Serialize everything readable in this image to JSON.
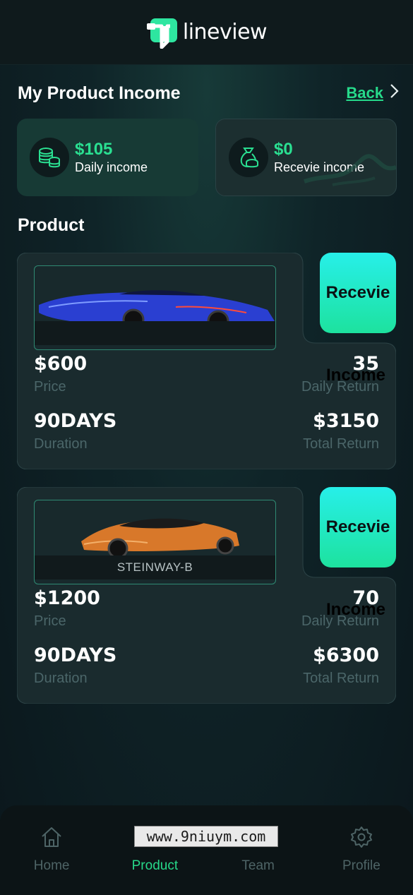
{
  "header": {
    "logo_text": "lineview"
  },
  "page": {
    "title": "My Product Income",
    "back_label": "Back"
  },
  "income_cards": [
    {
      "amount": "$105",
      "label": "Daily income",
      "icon": "coins-icon"
    },
    {
      "amount": "$0",
      "label": "Recevie income",
      "icon": "money-bag-icon"
    }
  ],
  "product_section": {
    "title": "Product"
  },
  "products": [
    {
      "car_name": "",
      "car_color": "#2a3fd1",
      "button_label": "Recevie",
      "overlay_text": "Income",
      "price": "$600",
      "price_label": "Price",
      "daily_return": "35",
      "daily_return_label": "Daily Return",
      "duration": "90DAYS",
      "duration_label": "Duration",
      "total_return": "$3150",
      "total_return_label": "Total Return"
    },
    {
      "car_name": "STEINWAY-B",
      "car_color": "#d8782a",
      "button_label": "Recevie",
      "overlay_text": "Income",
      "price": "$1200",
      "price_label": "Price",
      "daily_return": "70",
      "daily_return_label": "Daily Return",
      "duration": "90DAYS",
      "duration_label": "Duration",
      "total_return": "$6300",
      "total_return_label": "Total Return"
    }
  ],
  "tabbar": {
    "items": [
      {
        "label": "Home",
        "icon": "home-icon"
      },
      {
        "label": "Product",
        "icon": "product-icon",
        "active": true
      },
      {
        "label": "Team",
        "icon": "team-icon"
      },
      {
        "label": "Profile",
        "icon": "gear-icon"
      }
    ]
  },
  "watermark": "www.9niuym.com",
  "colors": {
    "accent": "#26d98a",
    "button_top": "#27efe9",
    "button_bottom": "#1de29e"
  }
}
